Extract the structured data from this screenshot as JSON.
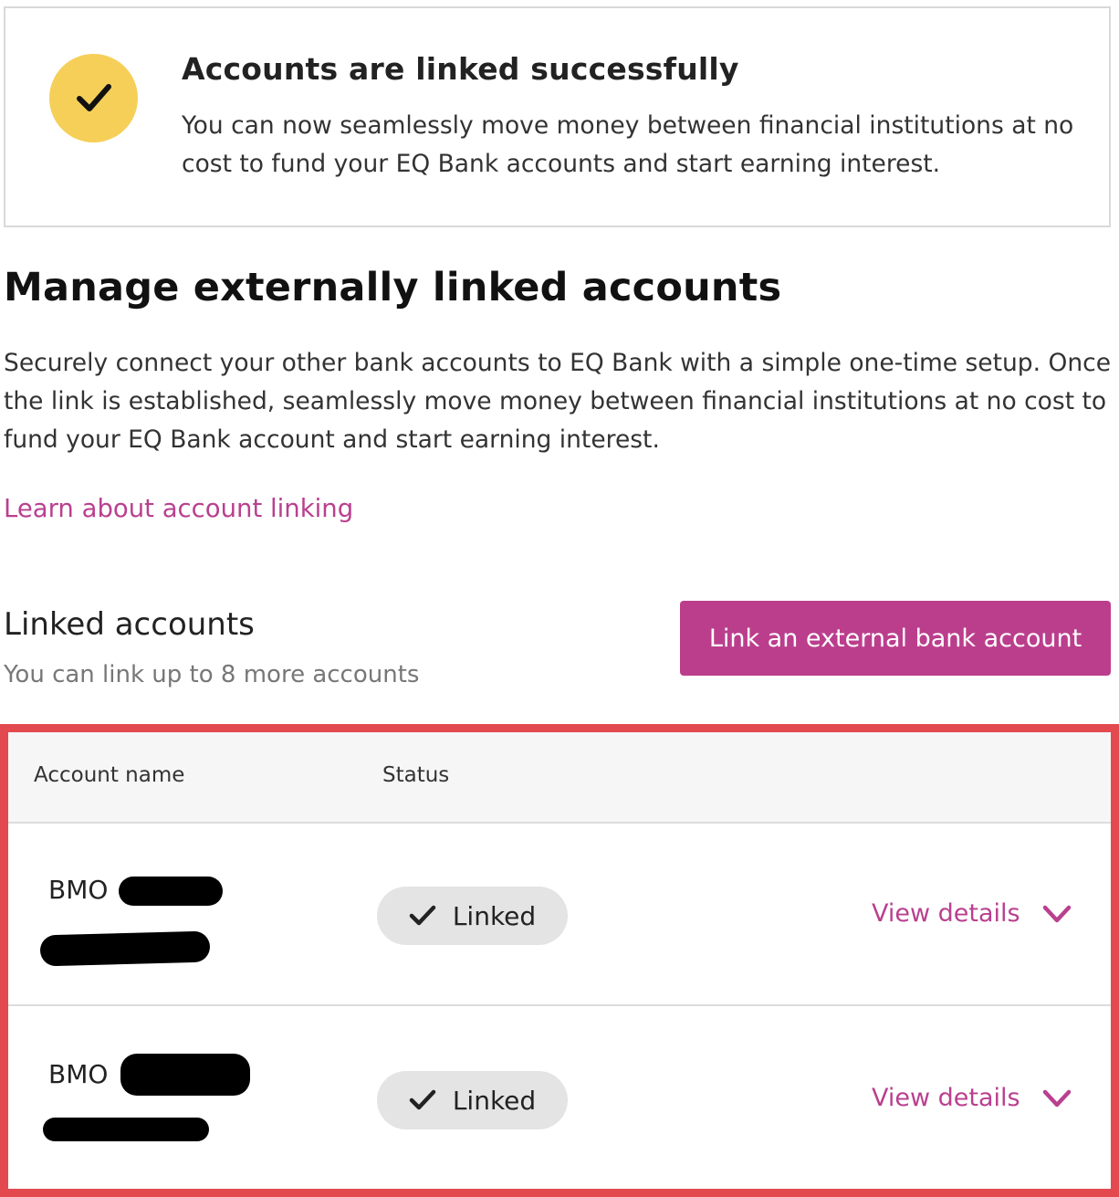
{
  "banner": {
    "title": "Accounts are linked successfully",
    "text": "You can now seamlessly move money between financial institutions at no cost to fund your EQ Bank accounts and start earning interest.",
    "icon": "checkmark-icon",
    "accent_color": "#f5cf58"
  },
  "manage": {
    "title": "Manage externally linked accounts",
    "description": "Securely connect your other bank accounts to EQ Bank with a simple one-time setup. Once the link is established, seamlessly move money between financial institutions at no cost to fund your EQ Bank account and start earning interest.",
    "learn_link": "Learn about account linking"
  },
  "linked": {
    "title": "Linked accounts",
    "subtitle": "You can link up to 8 more accounts",
    "link_button": "Link an external bank account"
  },
  "table": {
    "headers": [
      "Account name",
      "Status"
    ],
    "rows": [
      {
        "name": "BMO",
        "status": "Linked",
        "action": "View details"
      },
      {
        "name": "BMO",
        "status": "Linked",
        "action": "View details"
      }
    ]
  },
  "colors": {
    "brand": "#bb3e8d",
    "highlight": "#e34a4f",
    "pill": "#e4e4e4"
  }
}
